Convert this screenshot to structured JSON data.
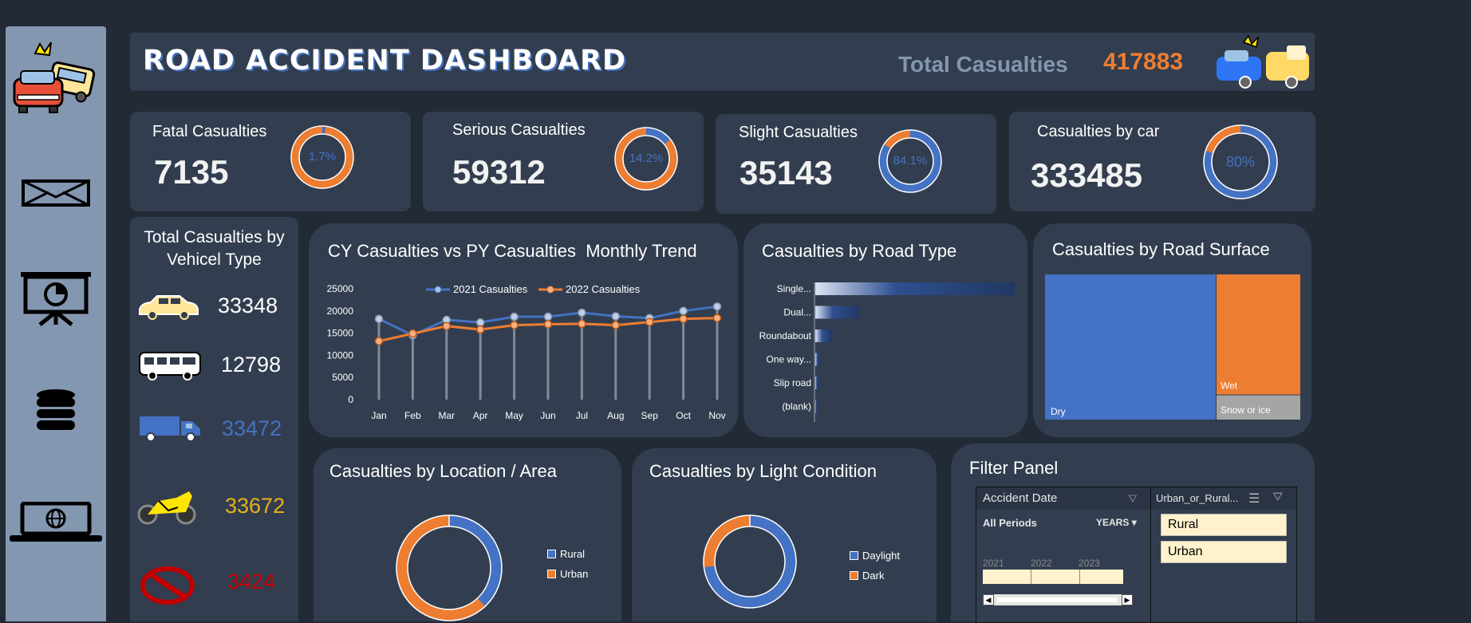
{
  "header": {
    "title": "ROAD ACCIDENT DASHBOARD",
    "total_label": "Total Casualties",
    "total_value": "417883"
  },
  "sidebar": {
    "items": [
      {
        "icon": "car-crash-icon"
      },
      {
        "icon": "mail-icon"
      },
      {
        "icon": "presentation-chart-icon"
      },
      {
        "icon": "database-icon"
      },
      {
        "icon": "laptop-globe-icon"
      }
    ]
  },
  "kpis": [
    {
      "label": "Fatal Casualties",
      "value": "7135",
      "pct_label": "1.7%",
      "pct": 1.7
    },
    {
      "label": "Serious Casualties",
      "value": "59312",
      "pct_label": "14.2%",
      "pct": 14.2
    },
    {
      "label": "Slight Casualties",
      "value": "35143",
      "pct_label": "84.1%",
      "pct": 84.1
    },
    {
      "label": "Casualties by car",
      "value": "333485",
      "pct_label": "80%",
      "pct": 80
    }
  ],
  "vehicle": {
    "title_line1": "Total Casualties by",
    "title_line2": "Vehicel Type",
    "items": [
      {
        "icon": "car-icon",
        "value": "33348",
        "color": "#ffe699"
      },
      {
        "icon": "bus-icon",
        "value": "12798",
        "color": "#ffffff"
      },
      {
        "icon": "truck-icon",
        "value": "33472",
        "color": "#4472c4"
      },
      {
        "icon": "motorcycle-icon",
        "value": "33672",
        "color": "#e6b018"
      },
      {
        "icon": "no-entry-icon",
        "value": "3424",
        "color": "#c00000"
      }
    ]
  },
  "chart_data": [
    {
      "type": "line",
      "title": "CY Casualties vs PY Casualties  Monthly Trend",
      "categories": [
        "Jan",
        "Feb",
        "Mar",
        "Apr",
        "May",
        "Jun",
        "Jul",
        "Aug",
        "Sep",
        "Oct",
        "Nov"
      ],
      "series": [
        {
          "name": "2021 Casualties",
          "color": "#4472c4",
          "values": [
            18200,
            14500,
            18000,
            17400,
            18700,
            18700,
            19600,
            18800,
            18400,
            20000,
            21000
          ]
        },
        {
          "name": "2022 Casualties",
          "color": "#ed7d31",
          "values": [
            13200,
            14900,
            16600,
            15800,
            16800,
            17000,
            17100,
            16800,
            17500,
            18200,
            18400
          ]
        }
      ],
      "ylim": [
        0,
        25000
      ],
      "yticks": [
        "0",
        "5000",
        "10000",
        "15000",
        "20000",
        "25000"
      ]
    },
    {
      "type": "bar",
      "title": "Casualties by Road Type",
      "categories": [
        "Single...",
        "Dual...",
        "Roundabout",
        "One way...",
        "Slip road",
        "(blank)"
      ],
      "values": [
        309698,
        67373,
        26828,
        7389,
        5034,
        1561
      ]
    },
    {
      "type": "treemap",
      "title": "Casualties by Road Surface",
      "categories": [
        "Dry",
        "Wet",
        "Snow or ice"
      ],
      "values": [
        279445,
        115261,
        23177
      ],
      "colors": [
        "#4472c4",
        "#ed7d31",
        "#a5a5a5"
      ]
    },
    {
      "type": "pie",
      "title": "Casualties by Location / Area",
      "categories": [
        "Rural",
        "Urban"
      ],
      "values": [
        38,
        62
      ],
      "colors": [
        "#4472c4",
        "#ed7d31"
      ]
    },
    {
      "type": "pie",
      "title": "Casualties by Light Condition",
      "categories": [
        "Daylight",
        "Dark"
      ],
      "values": [
        73,
        27
      ],
      "colors": [
        "#4472c4",
        "#ed7d31"
      ]
    }
  ],
  "filter": {
    "title": "Filter Panel",
    "timeline": {
      "label": "Accident Date",
      "period": "All Periods",
      "unit": "YEARS",
      "years": [
        "2021",
        "2022",
        "2023"
      ]
    },
    "slicer": {
      "label": "Urban_or_Rural...",
      "options": [
        "Rural",
        "Urban"
      ]
    }
  },
  "colors": {
    "accent_blue": "#4472c4",
    "accent_orange": "#ed7d31",
    "card": "#323e4f",
    "background": "#222a35"
  }
}
